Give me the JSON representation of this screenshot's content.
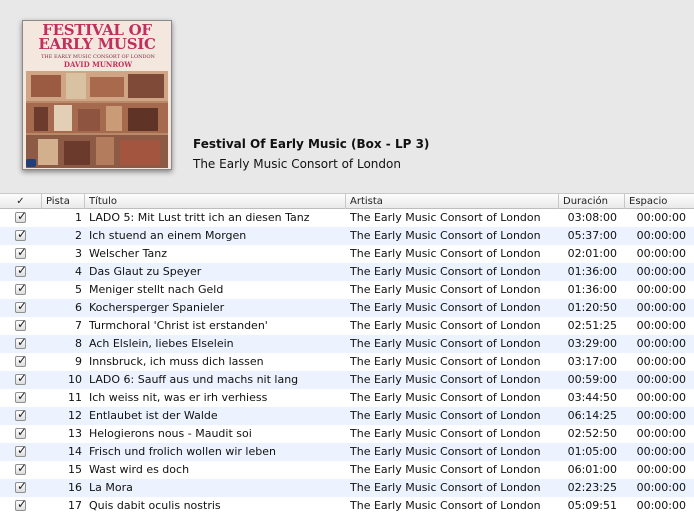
{
  "album": {
    "title": "Festival Of Early Music (Box - LP 3)",
    "artist": "The Early Music Consort of London",
    "cover": {
      "title_line1": "FESTIVAL OF",
      "title_line2": "EARLY MUSIC",
      "subtitle": "THE EARLY MUSIC CONSORT OF LONDON",
      "name": "DAVID MUNROW",
      "colors": {
        "title": "#c0305f",
        "background": "#f4e8de",
        "art": "#8a4b3a"
      }
    }
  },
  "columns": {
    "check": "✓",
    "track": "Pista",
    "title": "Título",
    "artist": "Artista",
    "duration": "Duración",
    "gap": "Espacio"
  },
  "tracks": [
    {
      "num": "1",
      "title": "LADO 5: Mit Lust tritt ich an diesen Tanz",
      "artist": "The Early Music Consort of London",
      "duration": "03:08:00",
      "gap": "00:00:00"
    },
    {
      "num": "2",
      "title": "Ich stuend an einem Morgen",
      "artist": "The Early Music Consort of London",
      "duration": "05:37:00",
      "gap": "00:00:00"
    },
    {
      "num": "3",
      "title": "Welscher Tanz",
      "artist": "The Early Music Consort of London",
      "duration": "02:01:00",
      "gap": "00:00:00"
    },
    {
      "num": "4",
      "title": "Das Glaut zu Speyer",
      "artist": "The Early Music Consort of London",
      "duration": "01:36:00",
      "gap": "00:00:00"
    },
    {
      "num": "5",
      "title": "Meniger stellt nach Geld",
      "artist": "The Early Music Consort of London",
      "duration": "01:36:00",
      "gap": "00:00:00"
    },
    {
      "num": "6",
      "title": "Kochersperger Spanieler",
      "artist": "The Early Music Consort of London",
      "duration": "01:20:50",
      "gap": "00:00:00"
    },
    {
      "num": "7",
      "title": "Turmchoral 'Christ ist erstanden'",
      "artist": "The Early Music Consort of London",
      "duration": "02:51:25",
      "gap": "00:00:00"
    },
    {
      "num": "8",
      "title": "Ach Elslein, liebes Elselein",
      "artist": "The Early Music Consort of London",
      "duration": "03:29:00",
      "gap": "00:00:00"
    },
    {
      "num": "9",
      "title": "Innsbruck, ich muss dich lassen",
      "artist": "The Early Music Consort of London",
      "duration": "03:17:00",
      "gap": "00:00:00"
    },
    {
      "num": "10",
      "title": "LADO 6: Sauff aus und machs nit lang",
      "artist": "The Early Music Consort of London",
      "duration": "00:59:00",
      "gap": "00:00:00"
    },
    {
      "num": "11",
      "title": "Ich weiss nit, was er irh verhiess",
      "artist": "The Early Music Consort of London",
      "duration": "03:44:50",
      "gap": "00:00:00"
    },
    {
      "num": "12",
      "title": "Entlaubet ist der Walde",
      "artist": "The Early Music Consort of London",
      "duration": "06:14:25",
      "gap": "00:00:00"
    },
    {
      "num": "13",
      "title": "Helogierons nous - Maudit soi",
      "artist": "The Early Music Consort of London",
      "duration": "02:52:50",
      "gap": "00:00:00"
    },
    {
      "num": "14",
      "title": "Frisch und frolich wollen wir leben",
      "artist": "The Early Music Consort of London",
      "duration": "01:05:00",
      "gap": "00:00:00"
    },
    {
      "num": "15",
      "title": "Wast wird es doch",
      "artist": "The Early Music Consort of London",
      "duration": "06:01:00",
      "gap": "00:00:00"
    },
    {
      "num": "16",
      "title": "La Mora",
      "artist": "The Early Music Consort of London",
      "duration": "02:23:25",
      "gap": "00:00:00"
    },
    {
      "num": "17",
      "title": "Quis dabit oculis nostris",
      "artist": "The Early Music Consort of London",
      "duration": "05:09:51",
      "gap": "00:00:00"
    }
  ],
  "colors": {
    "row_alt": "#edf3fe",
    "row": "#ffffff",
    "header_bg": "#e8e8e8"
  }
}
